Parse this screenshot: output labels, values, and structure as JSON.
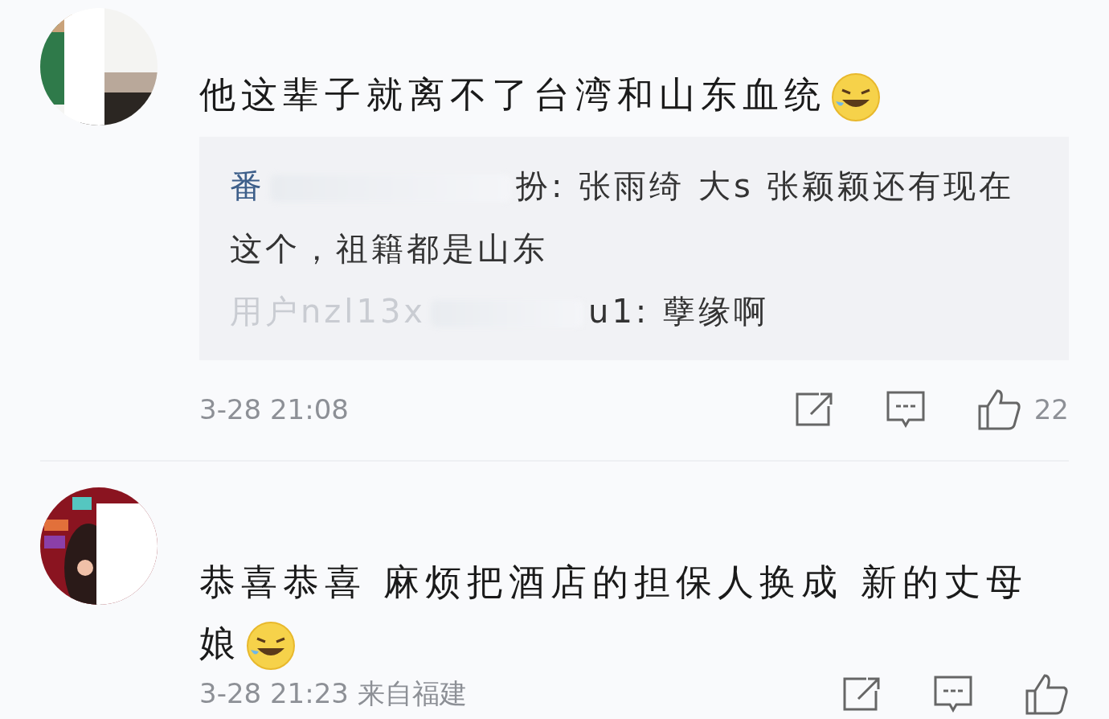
{
  "comments": [
    {
      "text": "他这辈子就离不了台湾和山东血统",
      "emoji": true,
      "replies": [
        {
          "name": "番",
          "blurred": true,
          "text": "扮: 张雨绮 大s 张颖颖还有现在这个，祖籍都是山东"
        },
        {
          "name": "用户nzl13x",
          "blurred": true,
          "text": "u1: 孽缘啊"
        }
      ],
      "time": "3-28 21:08",
      "likes": "22"
    },
    {
      "text": "恭喜恭喜 麻烦把酒店的担保人换成 新的丈母娘",
      "emoji": true,
      "time": "3-28 21:23",
      "location": "来自福建"
    }
  ]
}
